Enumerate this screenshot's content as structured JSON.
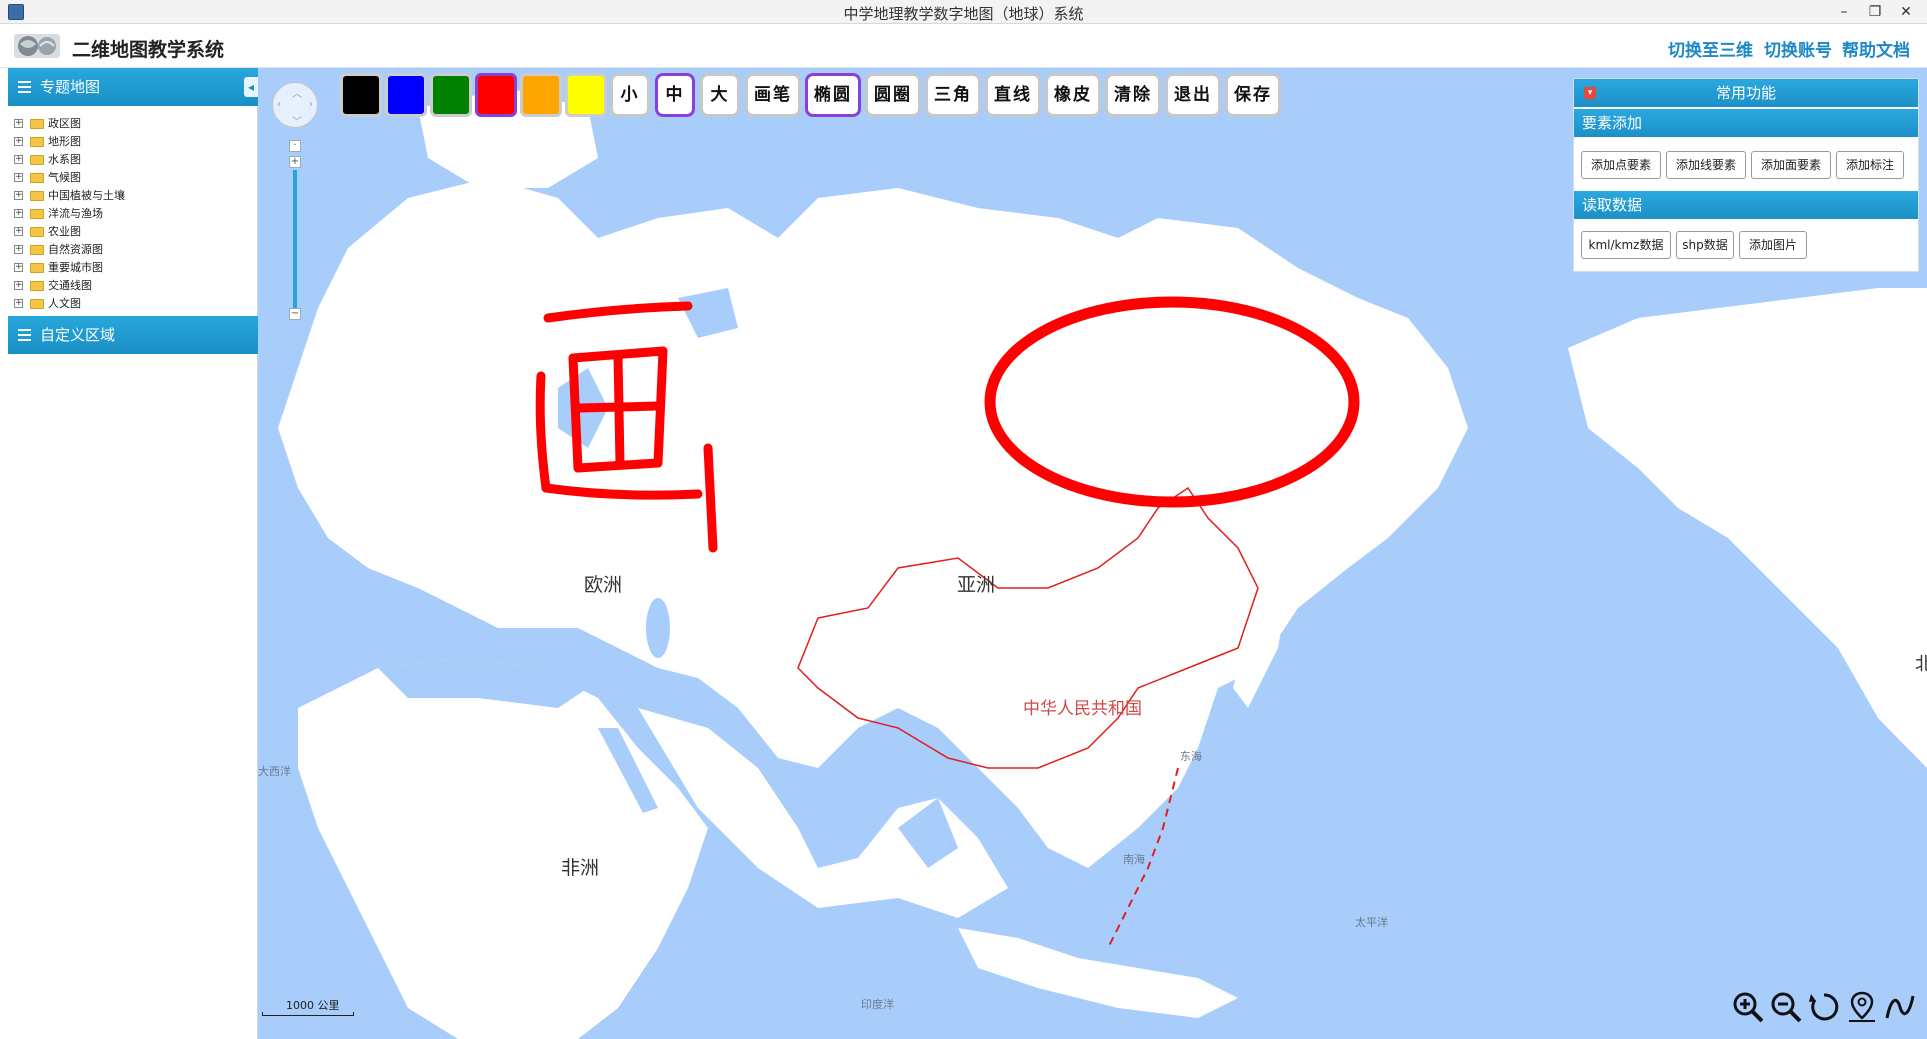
{
  "window": {
    "title": "中学地理教学数字地图（地球）系统",
    "controls": [
      "–",
      "❐",
      "✕"
    ]
  },
  "header": {
    "app_name": "二维地图教学系统",
    "links": [
      "切换至三维",
      "切换账号",
      "帮助文档"
    ]
  },
  "sidebar": {
    "thematic_title": "专题地图",
    "custom_title": "自定义区域",
    "items": [
      "政区图",
      "地形图",
      "水系图",
      "气候图",
      "中国植被与土壤",
      "洋流与渔场",
      "农业图",
      "自然资源图",
      "重要城市图",
      "交通线图",
      "人文图"
    ]
  },
  "draw_toolbar": {
    "colors": [
      "#000000",
      "#0000ff",
      "#008000",
      "#ff0000",
      "#ffa500",
      "#ffff00"
    ],
    "selected_color": "#ff0000",
    "sizes": [
      "小",
      "中",
      "大"
    ],
    "selected_size": "中",
    "tools": [
      "画笔",
      "椭圆",
      "圆圈",
      "三角",
      "直线",
      "橡皮",
      "清除",
      "退出",
      "保存"
    ],
    "active_tool": "椭圆"
  },
  "func_panel": {
    "title": "常用功能",
    "section_add": "要素添加",
    "add_buttons": [
      "添加点要素",
      "添加线要素",
      "添加面要素",
      "添加标注"
    ],
    "section_read": "读取数据",
    "read_buttons": [
      "kml/kmz数据",
      "shp数据",
      "添加图片"
    ]
  },
  "map": {
    "labels": {
      "europe": "欧洲",
      "asia": "亚洲",
      "africa": "非洲",
      "china": "中华人民共和国",
      "atlantic": "大西洋",
      "east_sea": "东海",
      "south_sea": "南海",
      "pacific": "太平洋",
      "indian": "印度洋",
      "north_america_partial": "北"
    },
    "scale_label": "1000 公里",
    "annotation_color": "#ff0000",
    "land_color": "#ffffff",
    "water_color": "#a8cdfb"
  },
  "map_tools": [
    "zoom-in-icon",
    "zoom-out-icon",
    "refresh-icon",
    "location-icon",
    "curve-icon"
  ]
}
